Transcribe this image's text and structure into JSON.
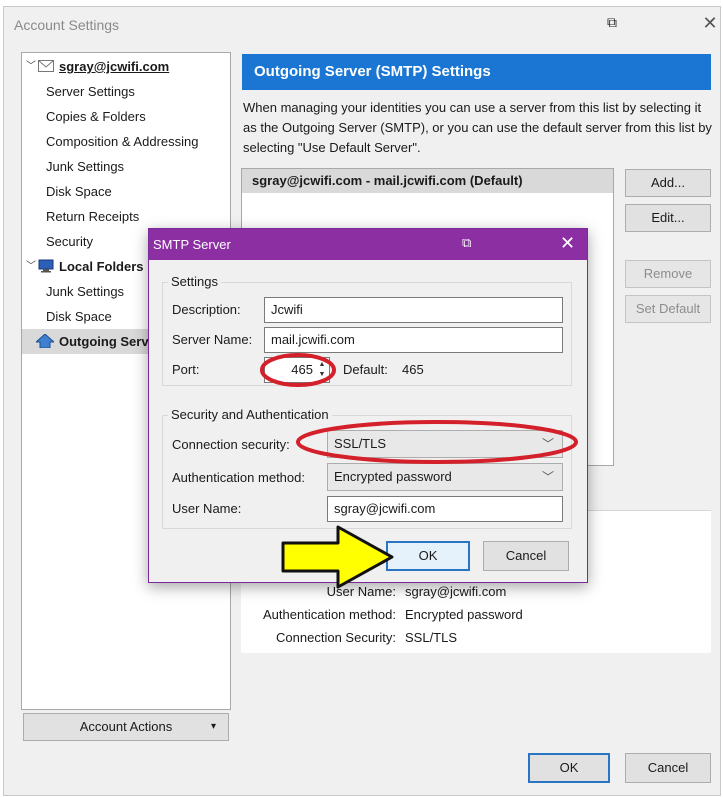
{
  "window": {
    "title": "Account Settings",
    "restore_glyph": "⧉",
    "close_glyph": "✕"
  },
  "tree": {
    "account": "sgray@jcwifi.com",
    "account_items": [
      "Server Settings",
      "Copies & Folders",
      "Composition & Addressing",
      "Junk Settings",
      "Disk Space",
      "Return Receipts",
      "Security"
    ],
    "local_folders": "Local Folders",
    "local_items": [
      "Junk Settings",
      "Disk Space"
    ],
    "outgoing": "Outgoing Server (SMTP)",
    "outgoing_visible": "Outgoing Serv"
  },
  "account_actions": {
    "label": "Account Actions",
    "arrow": "▾"
  },
  "panel": {
    "header": "Outgoing Server (SMTP) Settings",
    "description": "When managing your identities you can use a server from this list by selecting it as the Outgoing Server (SMTP), or you can use the default server from this list by selecting \"Use Default Server\".",
    "server_row": "sgray@jcwifi.com - mail.jcwifi.com (Default)",
    "buttons": {
      "add": "Add...",
      "edit": "Edit...",
      "remove": "Remove",
      "set_default": "Set Default"
    },
    "details": {
      "user_name_label": "User Name:",
      "user_name_value": "sgray@jcwifi.com",
      "auth_label": "Authentication method:",
      "auth_value": "Encrypted password",
      "conn_label": "Connection Security:",
      "conn_value": "SSL/TLS"
    }
  },
  "footer": {
    "ok": "OK",
    "cancel": "Cancel"
  },
  "dialog": {
    "title": "SMTP Server",
    "settings_group": "Settings",
    "description_label": "Description:",
    "description_value": "Jcwifi",
    "server_name_label": "Server Name:",
    "server_name_value": "mail.jcwifi.com",
    "port_label": "Port:",
    "port_value": "465",
    "port_default_label": "Default:",
    "port_default_value": "465",
    "security_group": "Security and Authentication",
    "conn_label": "Connection security:",
    "conn_value": "SSL/TLS",
    "auth_label": "Authentication method:",
    "auth_value": "Encrypted password",
    "user_label": "User Name:",
    "user_value": "sgray@jcwifi.com",
    "ok": "OK",
    "cancel": "Cancel"
  },
  "annotation_colors": {
    "ellipse": "#d4202a",
    "arrow_fill": "#ffff00",
    "dialog_title_bar": "#8b2fa3",
    "header_blue": "#1a76d2"
  }
}
